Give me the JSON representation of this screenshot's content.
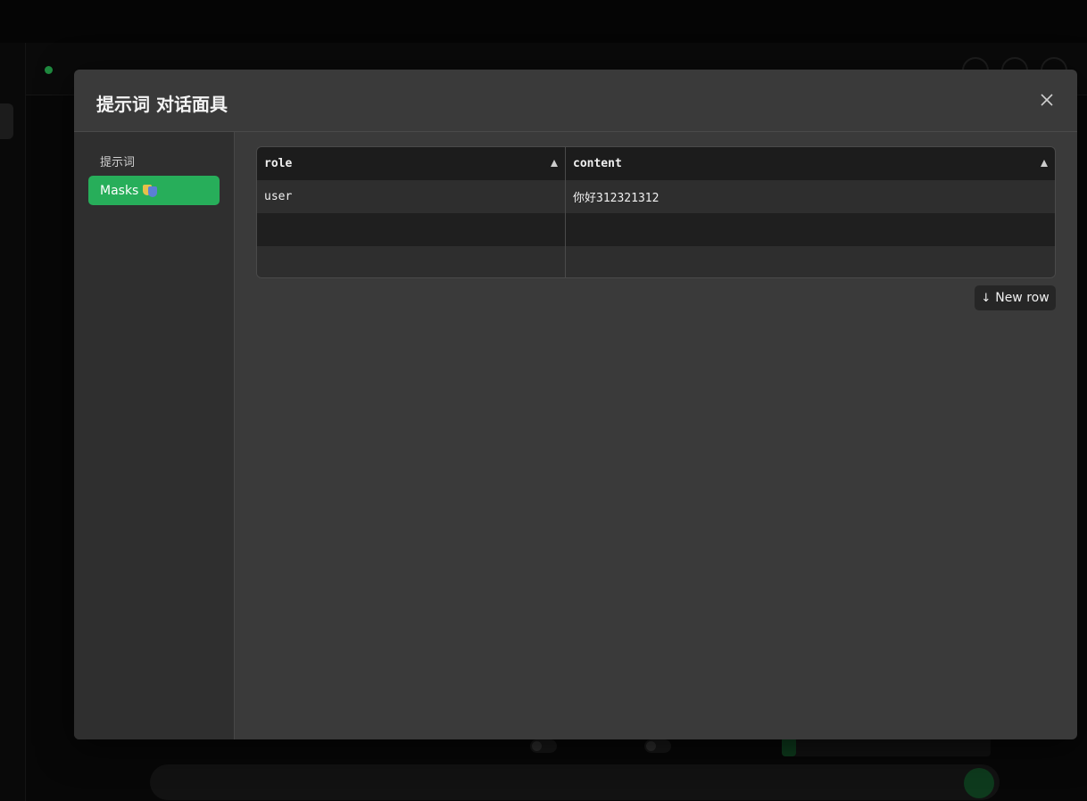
{
  "modal": {
    "title": "提示词 对话面具"
  },
  "sidebar": {
    "section_label": "提示词",
    "items": [
      {
        "label": "Masks",
        "active": true,
        "icon": "performing-arts-mask-icon"
      }
    ]
  },
  "grid": {
    "columns": [
      "role",
      "content"
    ],
    "rows": [
      [
        "user",
        "你好312321312"
      ],
      [
        "",
        ""
      ],
      [
        "",
        ""
      ]
    ]
  },
  "actions": {
    "new_row_label": "New row"
  },
  "colors": {
    "accent": "#27ae5a",
    "modal_bg": "#3a3a3a",
    "sidebar_bg": "#2f2f2f"
  }
}
